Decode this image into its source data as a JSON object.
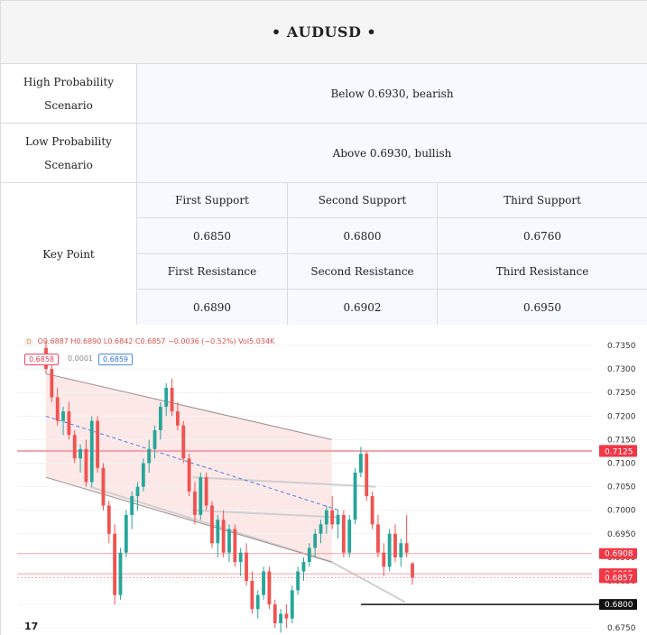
{
  "header": {
    "title": "•   AUDUSD   •"
  },
  "scenarios": {
    "high": {
      "label": "High Probability Scenario",
      "value": "Below 0.6930, bearish"
    },
    "low": {
      "label": "Low Probability Scenario",
      "value": "Above 0.6930, bullish"
    }
  },
  "key_point": {
    "label": "Key Point",
    "supports": [
      {
        "label": "First Support",
        "value": "0.6850"
      },
      {
        "label": "Second Support",
        "value": "0.6800"
      },
      {
        "label": "Third Support",
        "value": "0.6760"
      }
    ],
    "resistances": [
      {
        "label": "First Resistance",
        "value": "0.6890"
      },
      {
        "label": "Second Resistance",
        "value": "0.6902"
      },
      {
        "label": "Third Resistance",
        "value": "0.6950"
      }
    ]
  },
  "chart_header": {
    "symbol_icon": "D",
    "ohlc_text": "O0.6887 H0.6890 L0.6842 C0.6857 −0.0036 (−0.52%) Vol5.034K",
    "sell_price": "0.6858",
    "spread": "0.0001",
    "buy_price": "0.6859",
    "logo": "17"
  },
  "colors": {
    "up": "#26a69a",
    "down": "#ef5350",
    "channel_fill": "#fde4e4",
    "price_tag": "#f23645",
    "support_tag": "#111111"
  },
  "chart_data": {
    "type": "candlestick",
    "ylim": [
      0.6735,
      0.7375
    ],
    "y_ticks": [
      "0.7350",
      "0.7300",
      "0.7250",
      "0.7200",
      "0.7150",
      "0.7100",
      "0.7050",
      "0.7000",
      "0.6950",
      "0.6900",
      "0.6850",
      "0.6800",
      "0.6750"
    ],
    "price_tags": [
      {
        "label": "0.7127",
        "value": 0.7127,
        "kind": "red"
      },
      {
        "label": "0.7125",
        "value": 0.7125,
        "kind": "red"
      },
      {
        "label": "0.6908",
        "value": 0.6908,
        "kind": "red"
      },
      {
        "label": "0.6865",
        "value": 0.6865,
        "kind": "red"
      },
      {
        "label": "0.6857",
        "value": 0.6857,
        "kind": "red"
      },
      {
        "label": "0.6800",
        "value": 0.68,
        "kind": "black"
      }
    ],
    "candles": [
      [
        0.7345,
        0.736,
        0.729,
        0.73
      ],
      [
        0.73,
        0.731,
        0.723,
        0.724
      ],
      [
        0.724,
        0.726,
        0.718,
        0.719
      ],
      [
        0.719,
        0.722,
        0.716,
        0.721
      ],
      [
        0.721,
        0.723,
        0.715,
        0.716
      ],
      [
        0.716,
        0.717,
        0.71,
        0.711
      ],
      [
        0.711,
        0.714,
        0.708,
        0.713
      ],
      [
        0.713,
        0.715,
        0.705,
        0.706
      ],
      [
        0.706,
        0.72,
        0.705,
        0.719
      ],
      [
        0.719,
        0.72,
        0.708,
        0.709
      ],
      [
        0.709,
        0.71,
        0.7,
        0.701
      ],
      [
        0.701,
        0.702,
        0.693,
        0.695
      ],
      [
        0.695,
        0.697,
        0.68,
        0.682
      ],
      [
        0.682,
        0.692,
        0.681,
        0.691
      ],
      [
        0.691,
        0.7,
        0.69,
        0.699
      ],
      [
        0.699,
        0.704,
        0.696,
        0.703
      ],
      [
        0.703,
        0.706,
        0.7,
        0.705
      ],
      [
        0.705,
        0.711,
        0.704,
        0.71
      ],
      [
        0.71,
        0.715,
        0.708,
        0.713
      ],
      [
        0.713,
        0.718,
        0.711,
        0.717
      ],
      [
        0.717,
        0.723,
        0.715,
        0.722
      ],
      [
        0.722,
        0.727,
        0.72,
        0.726
      ],
      [
        0.726,
        0.728,
        0.72,
        0.721
      ],
      [
        0.721,
        0.723,
        0.717,
        0.718
      ],
      [
        0.718,
        0.719,
        0.71,
        0.711
      ],
      [
        0.711,
        0.712,
        0.703,
        0.704
      ],
      [
        0.704,
        0.706,
        0.697,
        0.699
      ],
      [
        0.699,
        0.708,
        0.698,
        0.707
      ],
      [
        0.707,
        0.708,
        0.7,
        0.701
      ],
      [
        0.701,
        0.702,
        0.692,
        0.693
      ],
      [
        0.693,
        0.699,
        0.69,
        0.698
      ],
      [
        0.698,
        0.7,
        0.69,
        0.691
      ],
      [
        0.691,
        0.697,
        0.689,
        0.696
      ],
      [
        0.696,
        0.697,
        0.688,
        0.689
      ],
      [
        0.689,
        0.692,
        0.686,
        0.691
      ],
      [
        0.691,
        0.693,
        0.684,
        0.685
      ],
      [
        0.685,
        0.687,
        0.678,
        0.679
      ],
      [
        0.679,
        0.683,
        0.677,
        0.682
      ],
      [
        0.682,
        0.688,
        0.681,
        0.687
      ],
      [
        0.687,
        0.688,
        0.679,
        0.68
      ],
      [
        0.68,
        0.681,
        0.675,
        0.676
      ],
      [
        0.676,
        0.679,
        0.674,
        0.678
      ],
      [
        0.678,
        0.68,
        0.675,
        0.677
      ],
      [
        0.677,
        0.684,
        0.676,
        0.683
      ],
      [
        0.683,
        0.688,
        0.682,
        0.687
      ],
      [
        0.687,
        0.69,
        0.685,
        0.689
      ],
      [
        0.689,
        0.693,
        0.688,
        0.692
      ],
      [
        0.692,
        0.696,
        0.69,
        0.695
      ],
      [
        0.695,
        0.698,
        0.693,
        0.697
      ],
      [
        0.697,
        0.701,
        0.695,
        0.7
      ],
      [
        0.7,
        0.703,
        0.696,
        0.697
      ],
      [
        0.697,
        0.7,
        0.694,
        0.699
      ],
      [
        0.699,
        0.7,
        0.69,
        0.691
      ],
      [
        0.691,
        0.699,
        0.69,
        0.698
      ],
      [
        0.698,
        0.709,
        0.697,
        0.708
      ],
      [
        0.708,
        0.7135,
        0.707,
        0.712
      ],
      [
        0.712,
        0.7125,
        0.702,
        0.703
      ],
      [
        0.703,
        0.704,
        0.696,
        0.697
      ],
      [
        0.697,
        0.699,
        0.69,
        0.691
      ],
      [
        0.691,
        0.693,
        0.686,
        0.688
      ],
      [
        0.688,
        0.696,
        0.687,
        0.695
      ],
      [
        0.695,
        0.697,
        0.689,
        0.69
      ],
      [
        0.69,
        0.694,
        0.688,
        0.693
      ],
      [
        0.693,
        0.699,
        0.69,
        0.691
      ],
      [
        0.6887,
        0.689,
        0.6842,
        0.6857
      ]
    ],
    "annotations": {
      "channel_upper": [
        [
          0,
          0.729
        ],
        [
          0.78,
          0.715
        ]
      ],
      "channel_lower": [
        [
          0,
          0.707
        ],
        [
          0.78,
          0.689
        ]
      ],
      "midline": [
        [
          0,
          0.72
        ],
        [
          0.8,
          0.7
        ]
      ],
      "extension": [
        [
          0.78,
          0.689
        ],
        [
          0.98,
          0.6805
        ]
      ],
      "grey_lines": [
        [
          [
            0.4,
            0.707
          ],
          [
            0.9,
            0.705
          ]
        ],
        [
          [
            0.4,
            0.7
          ],
          [
            0.8,
            0.6985
          ]
        ],
        [
          [
            0.12,
            0.705
          ],
          [
            0.78,
            0.689
          ]
        ]
      ],
      "support_line": [
        [
          0.86,
          0.68
        ],
        [
          1.25,
          0.68
        ]
      ]
    }
  }
}
